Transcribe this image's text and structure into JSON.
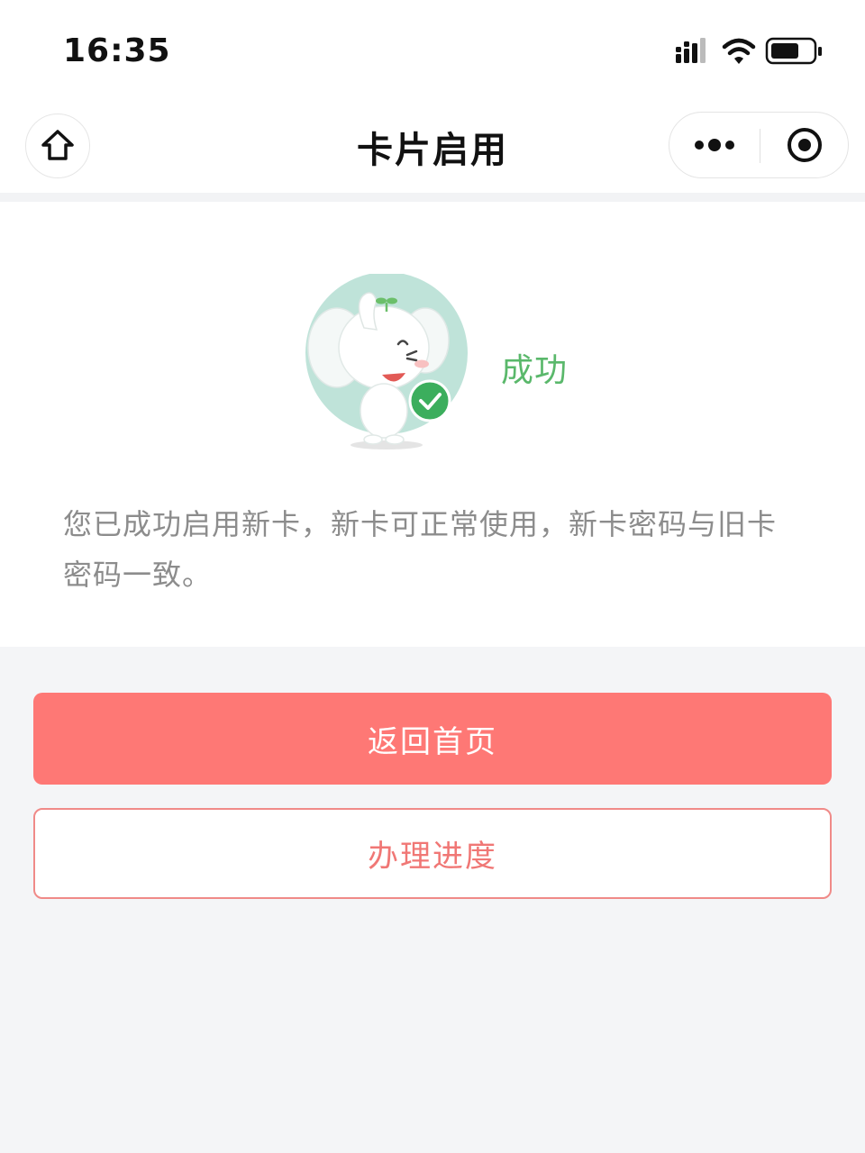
{
  "status_bar": {
    "time": "16:35",
    "icons": [
      "signal-icon",
      "wifi-icon",
      "battery-icon"
    ]
  },
  "nav": {
    "title": "卡片启用",
    "home_icon": "home-icon",
    "more_icon": "more-dots-icon",
    "close_icon": "target-close-icon"
  },
  "result": {
    "status_text": "成功",
    "message": "您已成功启用新卡，新卡可正常使用，新卡密码与旧卡密码一致。",
    "illustration": "elephant-mascot-success"
  },
  "actions": {
    "primary_label": "返回首页",
    "secondary_label": "办理进度"
  },
  "colors": {
    "accent": "#fe7875",
    "success": "#5ab86b",
    "text_muted": "#8c8c8c",
    "background": "#f4f5f7"
  }
}
